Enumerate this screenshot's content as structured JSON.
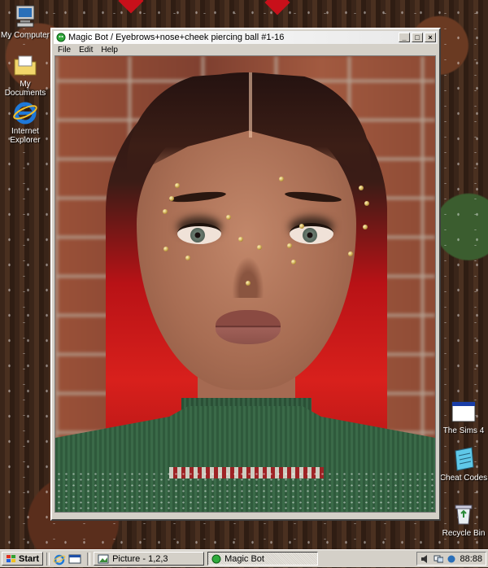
{
  "desktop": {
    "icons_left": [
      {
        "label": "My Computer",
        "icon": "my-computer-icon"
      },
      {
        "label": "My Documents",
        "icon": "my-documents-icon"
      },
      {
        "label": "Internet Explorer",
        "icon": "internet-explorer-icon"
      }
    ],
    "icons_right": [
      {
        "label": "The Sims 4",
        "icon": "sims-window-icon"
      },
      {
        "label": "Cheat Codes",
        "icon": "notepad-icon"
      },
      {
        "label": "Recycle Bin",
        "icon": "recycle-bin-icon"
      }
    ]
  },
  "window": {
    "title": "Magic Bot / Eyebrows+nose+cheek piercing ball #1-16",
    "menu": [
      "File",
      "Edit",
      "Help"
    ],
    "controls": [
      "_",
      "□",
      "×"
    ],
    "image_alt": "3D rendered woman with red hair and gold stud piercings around eyebrows, nose and cheeks, wearing a green knitted holiday sweater"
  },
  "taskbar": {
    "start_label": "Start",
    "tasks": [
      {
        "label": "Picture - 1,2,3",
        "active": false
      },
      {
        "label": "Magic Bot",
        "active": true
      }
    ],
    "clock": "88:88"
  },
  "colors": {
    "accent_red": "#c8101a",
    "window_face": "#d4d0c8"
  }
}
